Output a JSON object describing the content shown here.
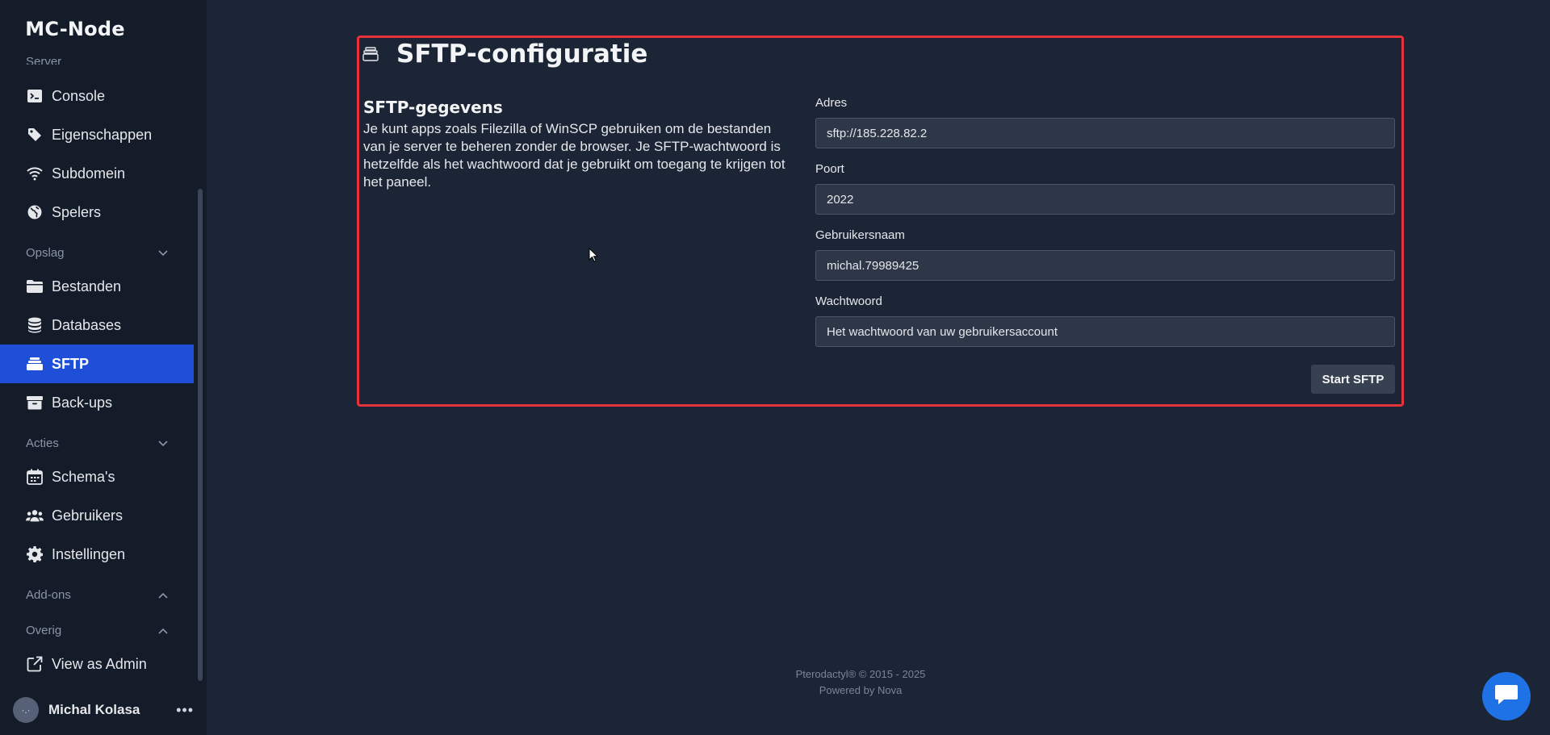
{
  "sidebar": {
    "brand": "MC-Node",
    "cut_label": "Server",
    "items": [
      {
        "label": "Console",
        "icon": "terminal-icon"
      },
      {
        "label": "Eigenschappen",
        "icon": "tag-icon"
      },
      {
        "label": "Subdomein",
        "icon": "wifi-icon"
      },
      {
        "label": "Spelers",
        "icon": "globe-icon"
      },
      {
        "label": "Bestanden",
        "icon": "folder-icon"
      },
      {
        "label": "Databases",
        "icon": "database-icon"
      },
      {
        "label": "SFTP",
        "icon": "sftp-icon",
        "active": true
      },
      {
        "label": "Back-ups",
        "icon": "archive-icon"
      },
      {
        "label": "Schema's",
        "icon": "calendar-icon"
      },
      {
        "label": "Gebruikers",
        "icon": "users-icon"
      },
      {
        "label": "Instellingen",
        "icon": "gear-icon"
      },
      {
        "label": "View as Admin",
        "icon": "external-link-icon"
      }
    ],
    "sections": {
      "opslag": "Opslag",
      "acties": "Acties",
      "addons": "Add-ons",
      "overig": "Overig"
    },
    "user": {
      "name": "Michal Kolasa",
      "avatar": "·.·"
    }
  },
  "main": {
    "title": "SFTP-configuratie",
    "info_title": "SFTP-gegevens",
    "info_text": "Je kunt apps zoals Filezilla of WinSCP gebruiken om de bestanden van je server te beheren zonder de browser. Je SFTP-wachtwoord is hetzelfde als het wachtwoord dat je gebruikt om toegang te krijgen tot het paneel.",
    "fields": {
      "address": {
        "label": "Adres",
        "value": "sftp://185.228.82.2"
      },
      "port": {
        "label": "Poort",
        "value": "2022"
      },
      "username": {
        "label": "Gebruikersnaam",
        "value": "michal.79989425"
      },
      "password": {
        "label": "Wachtwoord",
        "value": "Het wachtwoord van uw gebruikersaccount"
      }
    },
    "start_button": "Start SFTP"
  },
  "footer": {
    "line1": "Pterodactyl® © 2015 - 2025",
    "line2": "Powered by Nova"
  },
  "colors": {
    "accent": "#1f4fd8",
    "highlight_border": "#e5323b",
    "background": "#1c2536",
    "sidebar": "#141b29",
    "chat": "#1f72e5"
  }
}
